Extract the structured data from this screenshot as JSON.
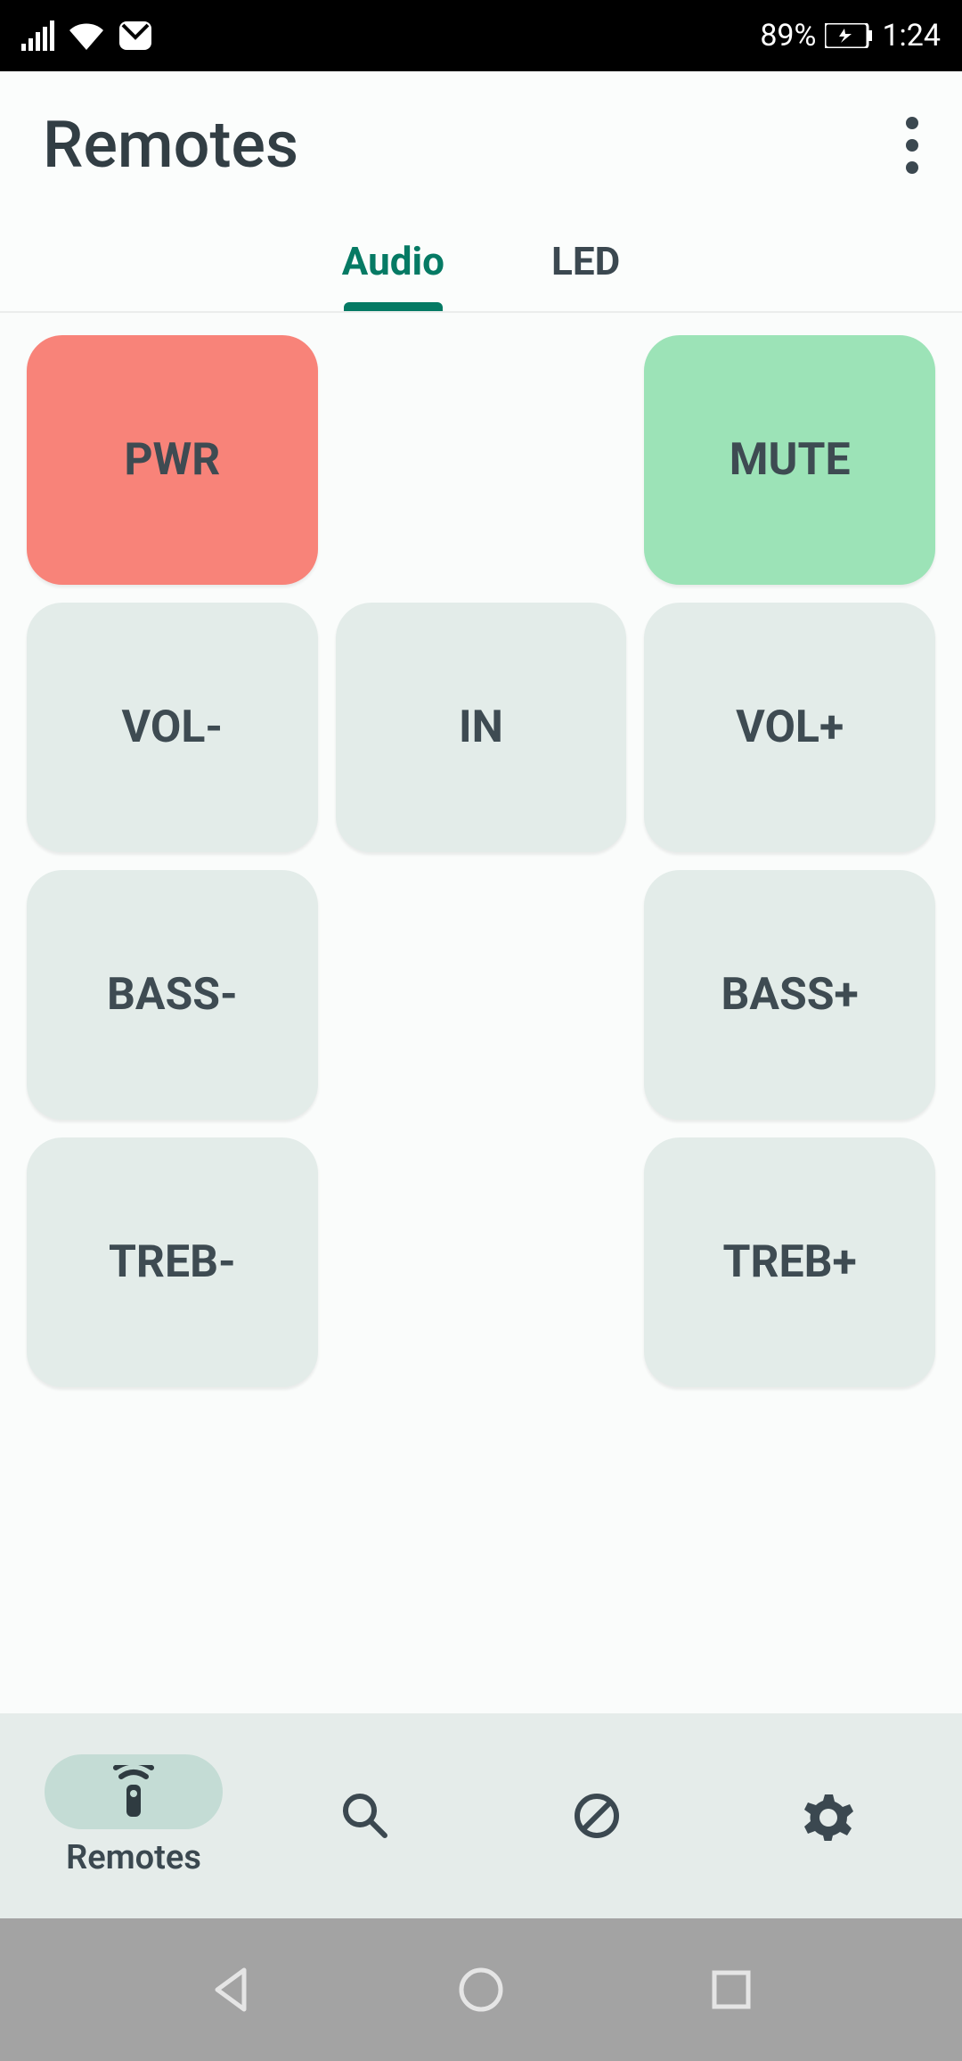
{
  "status": {
    "battery": "89%",
    "time": "1:24"
  },
  "header": {
    "title": "Remotes"
  },
  "tabs": {
    "t0": "Audio",
    "t1": "LED"
  },
  "buttons": {
    "pwr": "PWR",
    "mute": "MUTE",
    "volDown": "VOL-",
    "in": "IN",
    "volUp": "VOL+",
    "bassDown": "BASS-",
    "bassUp": "BASS+",
    "trebDown": "TREB-",
    "trebUp": "TREB+"
  },
  "nav": {
    "remotes": "Remotes"
  }
}
